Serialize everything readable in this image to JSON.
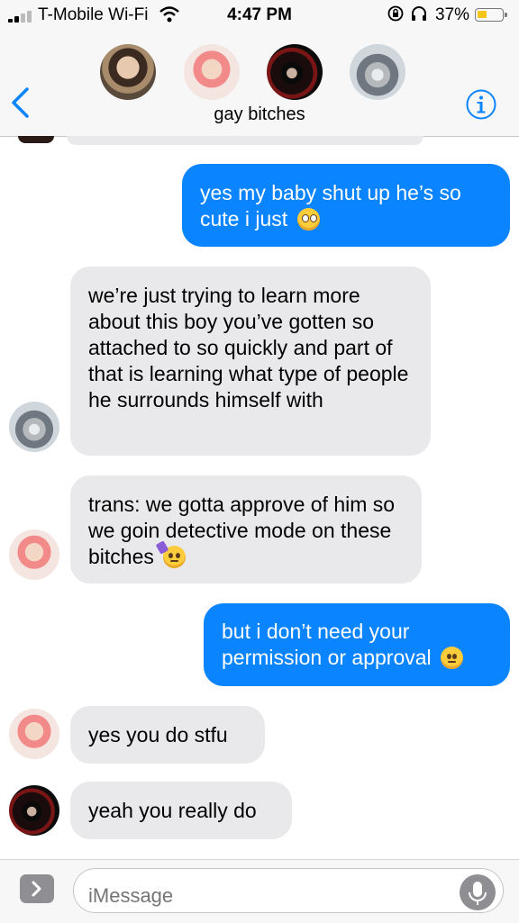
{
  "status_bar": {
    "carrier": "T-Mobile Wi-Fi",
    "time": "4:47 PM",
    "battery_pct": "37%",
    "battery_color": "#f5c518"
  },
  "header": {
    "group_name": "gay bitches",
    "avatars": [
      "member-1",
      "member-2",
      "member-3",
      "member-4"
    ],
    "accent": "#0a84ff"
  },
  "messages": [
    {
      "dir": "out",
      "text": "yes my baby shut up he’s so cute i just",
      "emoji": "pleading-face-emoji"
    },
    {
      "dir": "in",
      "sender_avatar": "member-4",
      "text": "we’re just trying to learn more about this boy you’ve gotten so attached to so quickly and part of that is learning what type of people he surrounds himself with"
    },
    {
      "dir": "in",
      "sender_avatar": "member-2",
      "text": "trans: we gotta approve of him so we goin detective mode on these bitches",
      "emoji": "partying-face-emoji"
    },
    {
      "dir": "out",
      "text": "but i don’t need your permission or approval",
      "emoji": "neutral-face-emoji"
    },
    {
      "dir": "in",
      "sender_avatar": "member-2",
      "text": "yes you do stfu"
    },
    {
      "dir": "in",
      "sender_avatar": "member-3",
      "text": "yeah you really do"
    }
  ],
  "compose": {
    "placeholder": "iMessage"
  }
}
